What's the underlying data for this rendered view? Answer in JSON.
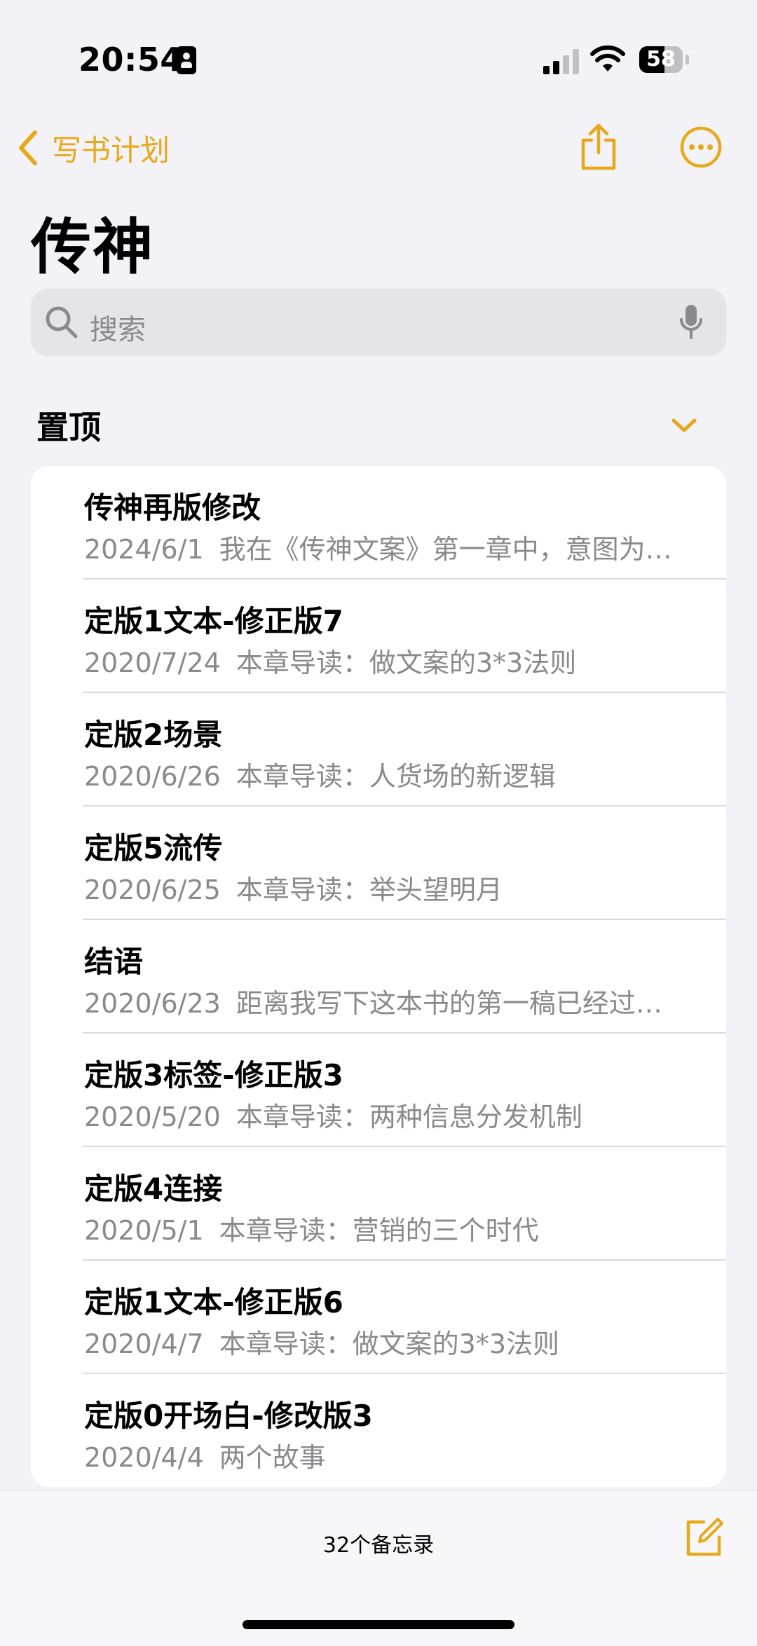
{
  "status": {
    "time": "20:54",
    "battery": "58",
    "battery_level": 0.58
  },
  "nav": {
    "back_label": "写书计划"
  },
  "page": {
    "title": "传神"
  },
  "search": {
    "placeholder": "搜索"
  },
  "section": {
    "label": "置顶"
  },
  "notes": [
    {
      "title": "传神再版修改",
      "date": "2024/6/1",
      "preview": "我在《传神文案》第一章中，意图为…"
    },
    {
      "title": "定版1文本-修正版7",
      "date": "2020/7/24",
      "preview": "本章导读：做文案的3*3法则"
    },
    {
      "title": "定版2场景",
      "date": "2020/6/26",
      "preview": "本章导读：人货场的新逻辑"
    },
    {
      "title": "定版5流传",
      "date": "2020/6/25",
      "preview": "本章导读：举头望明月"
    },
    {
      "title": "结语",
      "date": "2020/6/23",
      "preview": "距离我写下这本书的第一稿已经过…"
    },
    {
      "title": "定版3标签-修正版3",
      "date": "2020/5/20",
      "preview": "本章导读：两种信息分发机制"
    },
    {
      "title": "定版4连接",
      "date": "2020/5/1",
      "preview": "本章导读：营销的三个时代"
    },
    {
      "title": "定版1文本-修正版6",
      "date": "2020/4/7",
      "preview": "本章导读：做文案的3*3法则"
    },
    {
      "title": "定版0开场白-修改版3",
      "date": "2020/4/4",
      "preview": "两个故事"
    }
  ],
  "footer": {
    "count": "32个备忘录"
  },
  "colors": {
    "accent": "#E6A91A",
    "background": "#F2F2F7",
    "secondary_text": "#8A8A8E"
  },
  "icons": [
    "back-chevron-icon",
    "share-icon",
    "more-icon",
    "search-icon",
    "mic-icon",
    "chevron-down-icon",
    "compose-icon"
  ]
}
